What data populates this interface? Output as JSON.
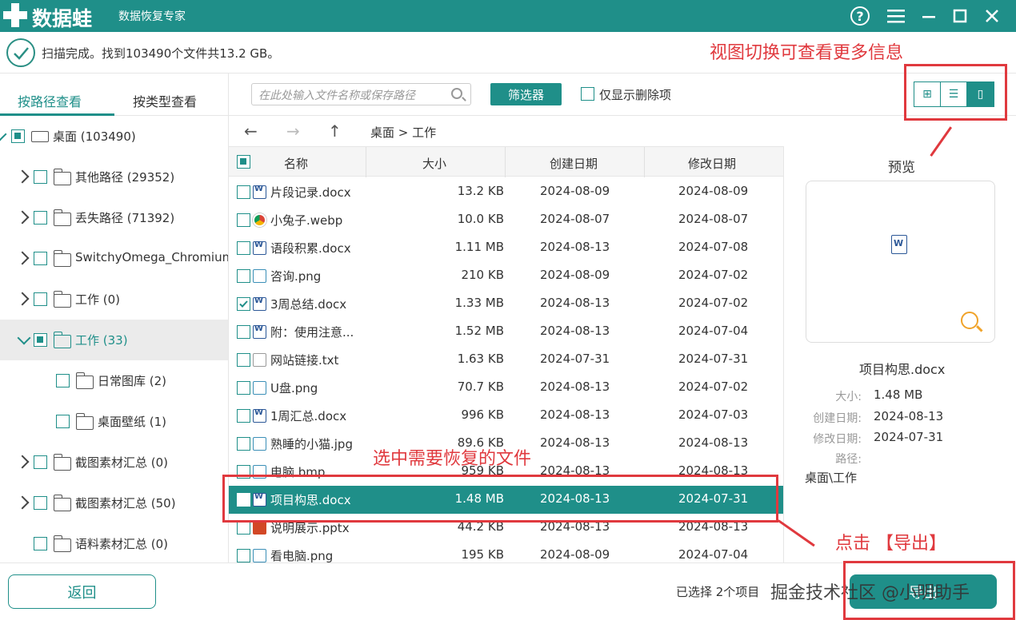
{
  "app": {
    "name": "数据蛙",
    "subtitle": "数据恢复专家"
  },
  "titlebar": {
    "help_icon": "help-circle-icon",
    "menu_icon": "hamburger-icon",
    "min_icon": "minimize-icon",
    "max_icon": "maximize-icon",
    "close_icon": "close-icon",
    "help_glyph": "?"
  },
  "status": {
    "text": "扫描完成。找到103490个文件共13.2 GB。"
  },
  "sidebar": {
    "tabs": [
      {
        "label": "按路径查看",
        "active": true
      },
      {
        "label": "按类型查看",
        "active": false
      }
    ],
    "tree": [
      {
        "label": "桌面 (103490)",
        "level": 0,
        "expand": "down",
        "check": "partial",
        "icon": "drive"
      },
      {
        "label": "其他路径 (29352)",
        "level": 1,
        "expand": "right",
        "check": "none",
        "icon": "folder"
      },
      {
        "label": "丢失路径 (71392)",
        "level": 1,
        "expand": "right",
        "check": "none",
        "icon": "folder"
      },
      {
        "label": "SwitchyOmega_Chromium",
        "level": 1,
        "expand": "right",
        "check": "none",
        "icon": "folder"
      },
      {
        "label": "工作 (0)",
        "level": 1,
        "expand": "right",
        "check": "none",
        "icon": "folder"
      },
      {
        "label": "工作 (33)",
        "level": 1,
        "expand": "down",
        "check": "partial",
        "icon": "folder",
        "selected": true
      },
      {
        "label": "日常图库 (2)",
        "level": 2,
        "expand": "none",
        "check": "none",
        "icon": "folder"
      },
      {
        "label": "桌面壁纸 (1)",
        "level": 2,
        "expand": "none",
        "check": "none",
        "icon": "folder"
      },
      {
        "label": "截图素材汇总 (0)",
        "level": 1,
        "expand": "right",
        "check": "none",
        "icon": "folder"
      },
      {
        "label": "截图素材汇总 (50)",
        "level": 1,
        "expand": "right",
        "check": "none",
        "icon": "folder"
      },
      {
        "label": "语料素材汇总 (0)",
        "level": 1,
        "expand": "none",
        "check": "none",
        "icon": "folder"
      }
    ]
  },
  "toolbar": {
    "search_placeholder": "在此处输入文件名称或保存路径",
    "filter_label": "筛选器",
    "only_deleted_label": "仅显示删除项",
    "view_modes": [
      {
        "icon": "grid-view-icon",
        "glyph": "⊞"
      },
      {
        "icon": "list-view-icon",
        "glyph": "☰"
      },
      {
        "icon": "preview-view-icon",
        "glyph": "▯",
        "active": true
      }
    ]
  },
  "nav": {
    "back": "←",
    "forward": "→",
    "up": "↑",
    "breadcrumb": "桌面 > 工作"
  },
  "table": {
    "columns": [
      "名称",
      "大小",
      "创建日期",
      "修改日期"
    ],
    "rows": [
      {
        "name": "片段记录.docx",
        "size": "13.2 KB",
        "created": "2024-08-09",
        "modified": "2024-08-09",
        "type": "word",
        "checked": false
      },
      {
        "name": "小兔子.webp",
        "size": "10.0 KB",
        "created": "2024-08-07",
        "modified": "2024-08-07",
        "type": "chrome",
        "checked": false
      },
      {
        "name": "语段积累.docx",
        "size": "1.11 MB",
        "created": "2024-08-13",
        "modified": "2024-07-08",
        "type": "word",
        "checked": false
      },
      {
        "name": "咨询.png",
        "size": "210 KB",
        "created": "2024-08-09",
        "modified": "2024-07-02",
        "type": "img",
        "checked": false
      },
      {
        "name": "3周总结.docx",
        "size": "1.33 MB",
        "created": "2024-08-13",
        "modified": "2024-07-02",
        "type": "word",
        "checked": true
      },
      {
        "name": "附：使用注意...",
        "size": "1.52 MB",
        "created": "2024-08-13",
        "modified": "2024-07-04",
        "type": "word",
        "checked": false
      },
      {
        "name": "网站链接.txt",
        "size": "1.63 KB",
        "created": "2024-07-31",
        "modified": "2024-07-31",
        "type": "txt",
        "checked": false
      },
      {
        "name": "U盘.png",
        "size": "70.7 KB",
        "created": "2024-08-13",
        "modified": "2024-07-02",
        "type": "img",
        "checked": false
      },
      {
        "name": "1周汇总.docx",
        "size": "996 KB",
        "created": "2024-08-13",
        "modified": "2024-07-03",
        "type": "word",
        "checked": false
      },
      {
        "name": "熟睡的小猫.jpg",
        "size": "89.6 KB",
        "created": "2024-08-13",
        "modified": "2024-08-13",
        "type": "img",
        "checked": false
      },
      {
        "name": "电脑.bmp",
        "size": "959 KB",
        "created": "2024-08-13",
        "modified": "2024-08-13",
        "type": "img",
        "checked": false
      },
      {
        "name": "项目构思.docx",
        "size": "1.48 MB",
        "created": "2024-08-13",
        "modified": "2024-07-31",
        "type": "word",
        "checked": false,
        "highlight": true
      },
      {
        "name": "说明展示.pptx",
        "size": "44.2 KB",
        "created": "2024-08-13",
        "modified": "2024-08-13",
        "type": "ppt",
        "checked": false
      },
      {
        "name": "看电脑.png",
        "size": "195 KB",
        "created": "2024-08-09",
        "modified": "2024-07-04",
        "type": "img",
        "checked": false
      }
    ]
  },
  "preview": {
    "title": "预览",
    "file_name": "项目构思.docx",
    "size_label": "大小:",
    "size": "1.48 MB",
    "created_label": "创建日期:",
    "created": "2024-08-13",
    "modified_label": "修改日期:",
    "modified": "2024-07-31",
    "path_label": "路径:",
    "path": "桌面\\工作"
  },
  "footer": {
    "back_label": "返回",
    "selected_text": "已选择 2个项目",
    "export_label": "导出",
    "watermark": "掘金技术社区 @小明助手"
  },
  "annotations": {
    "view_switch": "视图切换可查看更多信息",
    "select_files": "选中需要恢复的文件",
    "click_export": "点击 【导出】",
    "color": "#e0393e"
  },
  "colors": {
    "accent": "#1f8f89"
  }
}
